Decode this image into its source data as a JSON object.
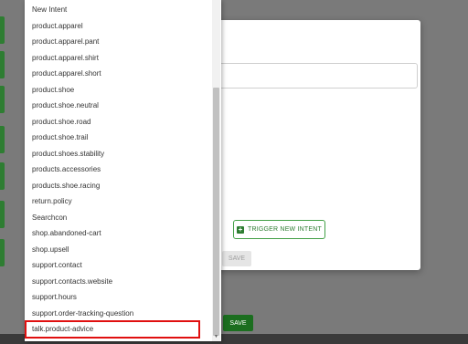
{
  "modal": {
    "trigger_label": "TRIGGER NEW INTENT",
    "save_disabled_label": "SAVE"
  },
  "footer": {
    "save_label": "SAVE"
  },
  "dropdown": {
    "items": [
      "New Intent",
      "product.apparel",
      "product.apparel.pant",
      "product.apparel.shirt",
      "product.apparel.short",
      "product.shoe",
      "product.shoe.neutral",
      "product.shoe.road",
      "product.shoe.trail",
      "product.shoes.stability",
      "products.accessories",
      "products.shoe.racing",
      "return.policy",
      "Searchcon",
      "shop.abandoned-cart",
      "shop.upsell",
      "support.contact",
      "support.contacts.website",
      "support.hours",
      "support.order-tracking-question",
      "talk.product-advice"
    ],
    "highlighted_item": "talk.product-advice"
  },
  "colors": {
    "accent": "#2e7d32",
    "highlight": "#e01010"
  }
}
